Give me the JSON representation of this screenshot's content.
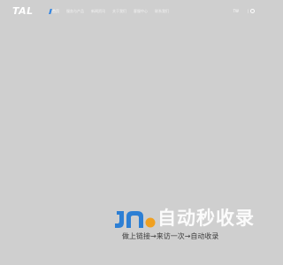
{
  "header": {
    "logo_text": "TAL",
    "nav_items": [
      "首页",
      "服务与产品",
      "新闻资讯",
      "关于我们",
      "客服中心",
      "联系我们"
    ],
    "lang_label": "TW",
    "lang_sep": "|"
  },
  "watermark": {
    "title": "自动秒收录",
    "subtitle": "做上链接→来访一次→自动收录"
  },
  "colors": {
    "background": "#cfcfcf",
    "accent": "#2a82e4",
    "watermark_logo": "#2d7fd4",
    "watermark_text": "#ffffff"
  }
}
